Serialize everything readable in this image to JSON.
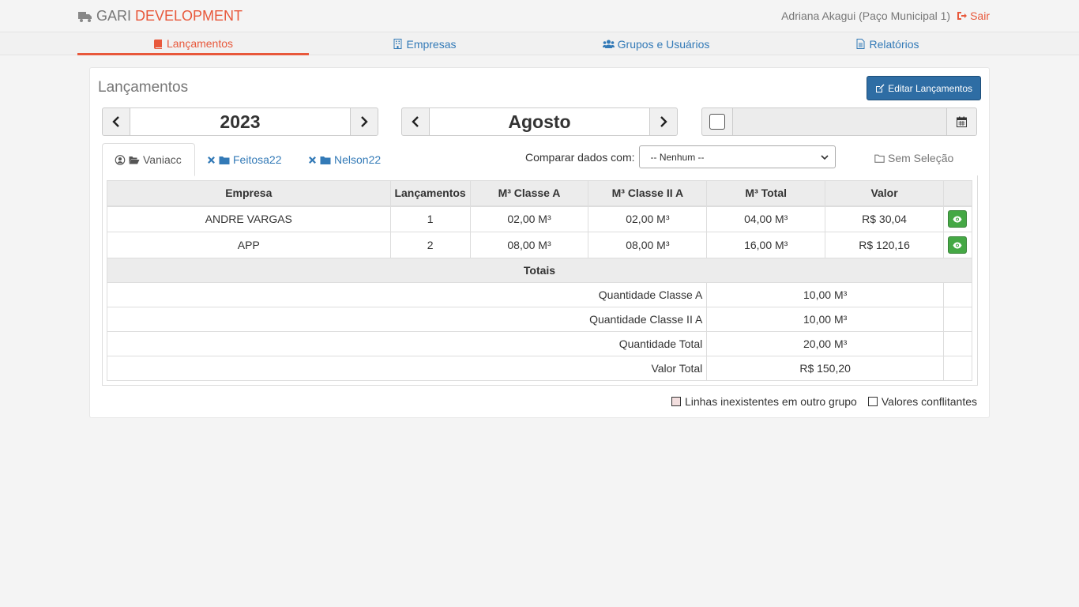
{
  "header": {
    "brand_part1": "GARI",
    "brand_part2": "DEVELOPMENT",
    "user_text": "Adriana Akagui (Paço Municipal 1)",
    "logout_label": "Sair"
  },
  "nav": {
    "items": [
      {
        "label": "Lançamentos",
        "icon": "book-icon"
      },
      {
        "label": "Empresas",
        "icon": "building-icon"
      },
      {
        "label": "Grupos e Usuários",
        "icon": "users-icon"
      },
      {
        "label": "Relatórios",
        "icon": "file-text-icon"
      }
    ],
    "active": "Lançamentos"
  },
  "panel": {
    "title": "Lançamentos",
    "edit_button": "Editar Lançamentos"
  },
  "filters": {
    "year": "2023",
    "month": "Agosto",
    "date_checked": false,
    "date_value": ""
  },
  "tabs": [
    {
      "label": "Vaniacc",
      "active": true
    },
    {
      "label": "Feitosa22",
      "active": false
    },
    {
      "label": "Nelson22",
      "active": false
    }
  ],
  "compare": {
    "label": "Comparar dados com:",
    "selected": "-- Nenhum --"
  },
  "selection_label": "Sem Seleção",
  "table": {
    "headers": [
      "Empresa",
      "Lançamentos",
      "M³ Classe A",
      "M³ Classe II A",
      "M³ Total",
      "Valor"
    ],
    "rows": [
      {
        "empresa": "ANDRE VARGAS",
        "lancamentos": "1",
        "classe_a": "02,00 M³",
        "classe_ii_a": "02,00 M³",
        "total": "04,00 M³",
        "valor": "R$ 30,04"
      },
      {
        "empresa": "APP",
        "lancamentos": "2",
        "classe_a": "08,00 M³",
        "classe_ii_a": "08,00 M³",
        "total": "16,00 M³",
        "valor": "R$ 120,16"
      }
    ],
    "totals_title": "Totais",
    "totals": [
      {
        "label": "Quantidade Classe A",
        "value": "10,00 M³"
      },
      {
        "label": "Quantidade Classe II A",
        "value": "10,00 M³"
      },
      {
        "label": "Quantidade Total",
        "value": "20,00 M³"
      },
      {
        "label": "Valor Total",
        "value": "R$ 150,20"
      }
    ]
  },
  "legend": {
    "missing_lines": "Linhas inexistentes em outro grupo",
    "missing_color": "#f2dede",
    "conflicting": "Valores conflitantes",
    "conflicting_color": "#ffffff"
  },
  "colors": {
    "accent": "#e8583b",
    "link": "#337ab7",
    "primary_button": "#2e6da4",
    "success_button": "#45a845"
  }
}
